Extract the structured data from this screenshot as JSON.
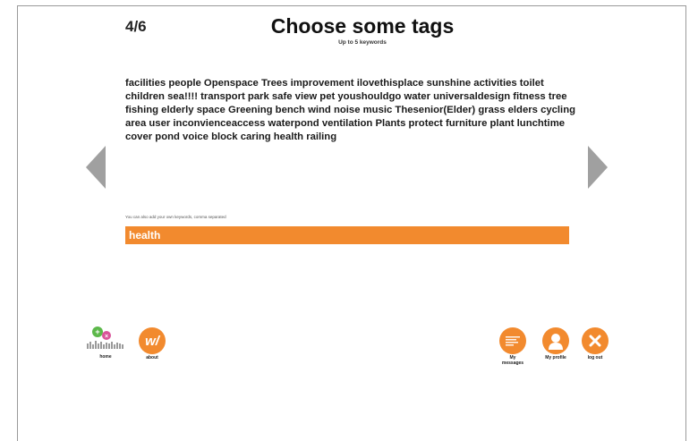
{
  "header": {
    "step": "4/6",
    "title": "Choose some tags",
    "subtitle": "Up to 5 keywords"
  },
  "tags": [
    "facilities",
    "people",
    "Openspace",
    "Trees",
    "improvement",
    "ilovethisplace",
    "sunshine",
    "activities",
    "toilet",
    "children",
    "sea!!!!",
    "transport",
    "park",
    "safe",
    "view",
    "pet",
    "youshouldgo",
    "water",
    "universaldesign",
    "fitness",
    "tree",
    "fishing",
    "elderly",
    "space",
    "Greening",
    "bench",
    "wind",
    "noise",
    "music",
    "Thesenior(Elder)",
    "grass",
    "elders",
    "cycling",
    "area",
    "user",
    "inconvienceaccess",
    "waterpond",
    "ventilation",
    "Plants",
    "protect",
    "furniture",
    "plant",
    "lunchtime",
    "cover",
    "pond",
    "voice",
    "block",
    "caring",
    "health",
    "railing"
  ],
  "input": {
    "hint": "You can also add your own keywords, comma separated",
    "value": "health"
  },
  "nav": {
    "prev_icon": "arrow-left-icon",
    "next_icon": "arrow-right-icon"
  },
  "footer": {
    "home": {
      "label": "home",
      "icon": "home-logo-icon"
    },
    "about": {
      "label": "about",
      "icon": "w-logo-icon",
      "glyph": "w/"
    },
    "messages": {
      "label_line1": "My",
      "label_line2": "messages",
      "icon": "messages-icon"
    },
    "profile": {
      "label": "My profile",
      "icon": "person-icon"
    },
    "logout": {
      "label": "log out",
      "icon": "close-icon"
    }
  },
  "colors": {
    "accent": "#f28a2e",
    "arrow": "#a0a0a0",
    "home_green": "#5cb84a",
    "home_pink": "#d9559a"
  }
}
